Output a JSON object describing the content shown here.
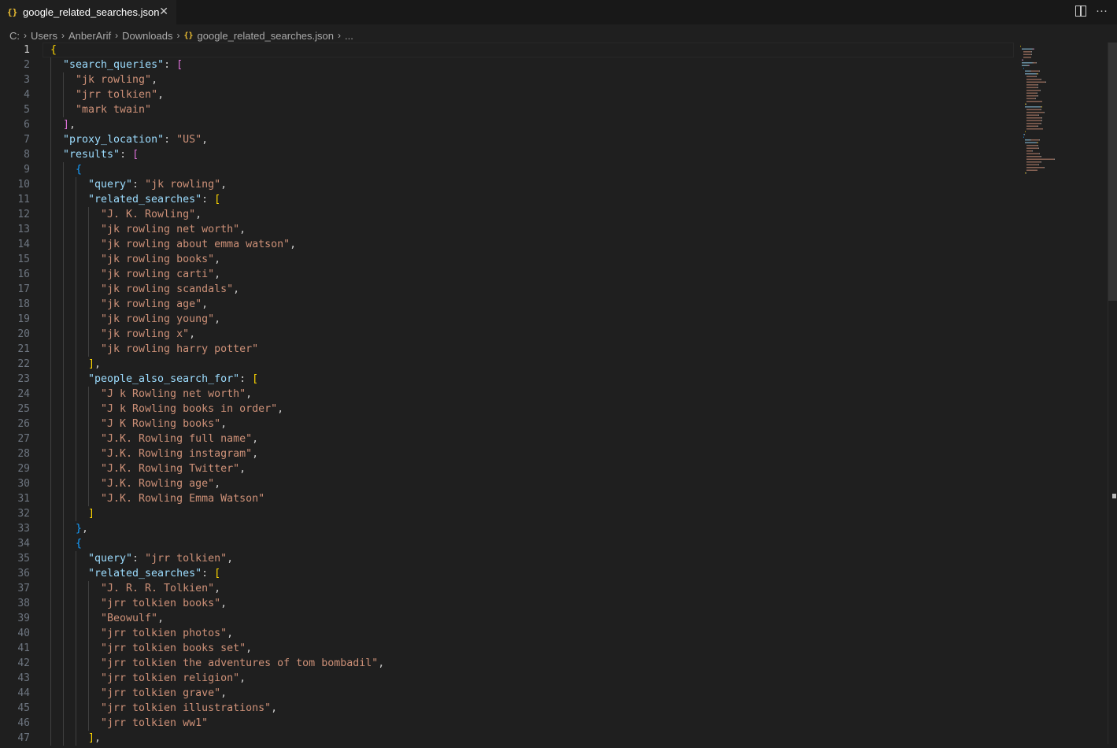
{
  "tab": {
    "icon": "{}",
    "title": "google_related_searches.json",
    "close_glyph": "✕",
    "more_glyph": "···"
  },
  "breadcrumb": {
    "items": [
      "C:",
      "Users",
      "AnberArif",
      "Downloads"
    ],
    "file_icon": "{}",
    "file": "google_related_searches.json",
    "more": "..."
  },
  "colors": {
    "key": "#9cdcfe",
    "string": "#ce9178",
    "bracket_level1": "#ffd700",
    "bracket_level2": "#da70d6",
    "bracket_level3": "#179fff"
  },
  "editor": {
    "active_line": 1,
    "lines": [
      {
        "n": "1",
        "indent": 0,
        "tokens": [
          {
            "t": "{",
            "c": "b1"
          }
        ]
      },
      {
        "n": "2",
        "indent": 1,
        "tokens": [
          {
            "t": "\"search_queries\"",
            "c": "k"
          },
          {
            "t": ": ",
            "c": "p"
          },
          {
            "t": "[",
            "c": "b2"
          }
        ]
      },
      {
        "n": "3",
        "indent": 2,
        "tokens": [
          {
            "t": "\"jk rowling\"",
            "c": "s"
          },
          {
            "t": ",",
            "c": "p"
          }
        ]
      },
      {
        "n": "4",
        "indent": 2,
        "tokens": [
          {
            "t": "\"jrr tolkien\"",
            "c": "s"
          },
          {
            "t": ",",
            "c": "p"
          }
        ]
      },
      {
        "n": "5",
        "indent": 2,
        "tokens": [
          {
            "t": "\"mark twain\"",
            "c": "s"
          }
        ]
      },
      {
        "n": "6",
        "indent": 1,
        "tokens": [
          {
            "t": "]",
            "c": "b2"
          },
          {
            "t": ",",
            "c": "p"
          }
        ]
      },
      {
        "n": "7",
        "indent": 1,
        "tokens": [
          {
            "t": "\"proxy_location\"",
            "c": "k"
          },
          {
            "t": ": ",
            "c": "p"
          },
          {
            "t": "\"US\"",
            "c": "s"
          },
          {
            "t": ",",
            "c": "p"
          }
        ]
      },
      {
        "n": "8",
        "indent": 1,
        "tokens": [
          {
            "t": "\"results\"",
            "c": "k"
          },
          {
            "t": ": ",
            "c": "p"
          },
          {
            "t": "[",
            "c": "b2"
          }
        ]
      },
      {
        "n": "9",
        "indent": 2,
        "tokens": [
          {
            "t": "{",
            "c": "b3"
          }
        ]
      },
      {
        "n": "10",
        "indent": 3,
        "tokens": [
          {
            "t": "\"query\"",
            "c": "k"
          },
          {
            "t": ": ",
            "c": "p"
          },
          {
            "t": "\"jk rowling\"",
            "c": "s"
          },
          {
            "t": ",",
            "c": "p"
          }
        ]
      },
      {
        "n": "11",
        "indent": 3,
        "tokens": [
          {
            "t": "\"related_searches\"",
            "c": "k"
          },
          {
            "t": ": ",
            "c": "p"
          },
          {
            "t": "[",
            "c": "b1"
          }
        ]
      },
      {
        "n": "12",
        "indent": 4,
        "tokens": [
          {
            "t": "\"J. K. Rowling\"",
            "c": "s"
          },
          {
            "t": ",",
            "c": "p"
          }
        ]
      },
      {
        "n": "13",
        "indent": 4,
        "tokens": [
          {
            "t": "\"jk rowling net worth\"",
            "c": "s"
          },
          {
            "t": ",",
            "c": "p"
          }
        ]
      },
      {
        "n": "14",
        "indent": 4,
        "tokens": [
          {
            "t": "\"jk rowling about emma watson\"",
            "c": "s"
          },
          {
            "t": ",",
            "c": "p"
          }
        ]
      },
      {
        "n": "15",
        "indent": 4,
        "tokens": [
          {
            "t": "\"jk rowling books\"",
            "c": "s"
          },
          {
            "t": ",",
            "c": "p"
          }
        ]
      },
      {
        "n": "16",
        "indent": 4,
        "tokens": [
          {
            "t": "\"jk rowling carti\"",
            "c": "s"
          },
          {
            "t": ",",
            "c": "p"
          }
        ]
      },
      {
        "n": "17",
        "indent": 4,
        "tokens": [
          {
            "t": "\"jk rowling scandals\"",
            "c": "s"
          },
          {
            "t": ",",
            "c": "p"
          }
        ]
      },
      {
        "n": "18",
        "indent": 4,
        "tokens": [
          {
            "t": "\"jk rowling age\"",
            "c": "s"
          },
          {
            "t": ",",
            "c": "p"
          }
        ]
      },
      {
        "n": "19",
        "indent": 4,
        "tokens": [
          {
            "t": "\"jk rowling young\"",
            "c": "s"
          },
          {
            "t": ",",
            "c": "p"
          }
        ]
      },
      {
        "n": "20",
        "indent": 4,
        "tokens": [
          {
            "t": "\"jk rowling x\"",
            "c": "s"
          },
          {
            "t": ",",
            "c": "p"
          }
        ]
      },
      {
        "n": "21",
        "indent": 4,
        "tokens": [
          {
            "t": "\"jk rowling harry potter\"",
            "c": "s"
          }
        ]
      },
      {
        "n": "22",
        "indent": 3,
        "tokens": [
          {
            "t": "]",
            "c": "b1"
          },
          {
            "t": ",",
            "c": "p"
          }
        ]
      },
      {
        "n": "23",
        "indent": 3,
        "tokens": [
          {
            "t": "\"people_also_search_for\"",
            "c": "k"
          },
          {
            "t": ": ",
            "c": "p"
          },
          {
            "t": "[",
            "c": "b1"
          }
        ]
      },
      {
        "n": "24",
        "indent": 4,
        "tokens": [
          {
            "t": "\"J k Rowling net worth\"",
            "c": "s"
          },
          {
            "t": ",",
            "c": "p"
          }
        ]
      },
      {
        "n": "25",
        "indent": 4,
        "tokens": [
          {
            "t": "\"J k Rowling books in order\"",
            "c": "s"
          },
          {
            "t": ",",
            "c": "p"
          }
        ]
      },
      {
        "n": "26",
        "indent": 4,
        "tokens": [
          {
            "t": "\"J K Rowling books\"",
            "c": "s"
          },
          {
            "t": ",",
            "c": "p"
          }
        ]
      },
      {
        "n": "27",
        "indent": 4,
        "tokens": [
          {
            "t": "\"J.K. Rowling full name\"",
            "c": "s"
          },
          {
            "t": ",",
            "c": "p"
          }
        ]
      },
      {
        "n": "28",
        "indent": 4,
        "tokens": [
          {
            "t": "\"J.K. Rowling instagram\"",
            "c": "s"
          },
          {
            "t": ",",
            "c": "p"
          }
        ]
      },
      {
        "n": "29",
        "indent": 4,
        "tokens": [
          {
            "t": "\"J.K. Rowling Twitter\"",
            "c": "s"
          },
          {
            "t": ",",
            "c": "p"
          }
        ]
      },
      {
        "n": "30",
        "indent": 4,
        "tokens": [
          {
            "t": "\"J.K. Rowling age\"",
            "c": "s"
          },
          {
            "t": ",",
            "c": "p"
          }
        ]
      },
      {
        "n": "31",
        "indent": 4,
        "tokens": [
          {
            "t": "\"J.K. Rowling Emma Watson\"",
            "c": "s"
          }
        ]
      },
      {
        "n": "32",
        "indent": 3,
        "tokens": [
          {
            "t": "]",
            "c": "b1"
          }
        ]
      },
      {
        "n": "33",
        "indent": 2,
        "tokens": [
          {
            "t": "}",
            "c": "b3"
          },
          {
            "t": ",",
            "c": "p"
          }
        ]
      },
      {
        "n": "34",
        "indent": 2,
        "tokens": [
          {
            "t": "{",
            "c": "b3"
          }
        ]
      },
      {
        "n": "35",
        "indent": 3,
        "tokens": [
          {
            "t": "\"query\"",
            "c": "k"
          },
          {
            "t": ": ",
            "c": "p"
          },
          {
            "t": "\"jrr tolkien\"",
            "c": "s"
          },
          {
            "t": ",",
            "c": "p"
          }
        ]
      },
      {
        "n": "36",
        "indent": 3,
        "tokens": [
          {
            "t": "\"related_searches\"",
            "c": "k"
          },
          {
            "t": ": ",
            "c": "p"
          },
          {
            "t": "[",
            "c": "b1"
          }
        ]
      },
      {
        "n": "37",
        "indent": 4,
        "tokens": [
          {
            "t": "\"J. R. R. Tolkien\"",
            "c": "s"
          },
          {
            "t": ",",
            "c": "p"
          }
        ]
      },
      {
        "n": "38",
        "indent": 4,
        "tokens": [
          {
            "t": "\"jrr tolkien books\"",
            "c": "s"
          },
          {
            "t": ",",
            "c": "p"
          }
        ]
      },
      {
        "n": "39",
        "indent": 4,
        "tokens": [
          {
            "t": "\"Beowulf\"",
            "c": "s"
          },
          {
            "t": ",",
            "c": "p"
          }
        ]
      },
      {
        "n": "40",
        "indent": 4,
        "tokens": [
          {
            "t": "\"jrr tolkien photos\"",
            "c": "s"
          },
          {
            "t": ",",
            "c": "p"
          }
        ]
      },
      {
        "n": "41",
        "indent": 4,
        "tokens": [
          {
            "t": "\"jrr tolkien books set\"",
            "c": "s"
          },
          {
            "t": ",",
            "c": "p"
          }
        ]
      },
      {
        "n": "42",
        "indent": 4,
        "tokens": [
          {
            "t": "\"jrr tolkien the adventures of tom bombadil\"",
            "c": "s"
          },
          {
            "t": ",",
            "c": "p"
          }
        ]
      },
      {
        "n": "43",
        "indent": 4,
        "tokens": [
          {
            "t": "\"jrr tolkien religion\"",
            "c": "s"
          },
          {
            "t": ",",
            "c": "p"
          }
        ]
      },
      {
        "n": "44",
        "indent": 4,
        "tokens": [
          {
            "t": "\"jrr tolkien grave\"",
            "c": "s"
          },
          {
            "t": ",",
            "c": "p"
          }
        ]
      },
      {
        "n": "45",
        "indent": 4,
        "tokens": [
          {
            "t": "\"jrr tolkien illustrations\"",
            "c": "s"
          },
          {
            "t": ",",
            "c": "p"
          }
        ]
      },
      {
        "n": "46",
        "indent": 4,
        "tokens": [
          {
            "t": "\"jrr tolkien ww1\"",
            "c": "s"
          }
        ]
      },
      {
        "n": "47",
        "indent": 3,
        "tokens": [
          {
            "t": "]",
            "c": "b1"
          },
          {
            "t": ",",
            "c": "p"
          }
        ]
      }
    ]
  }
}
